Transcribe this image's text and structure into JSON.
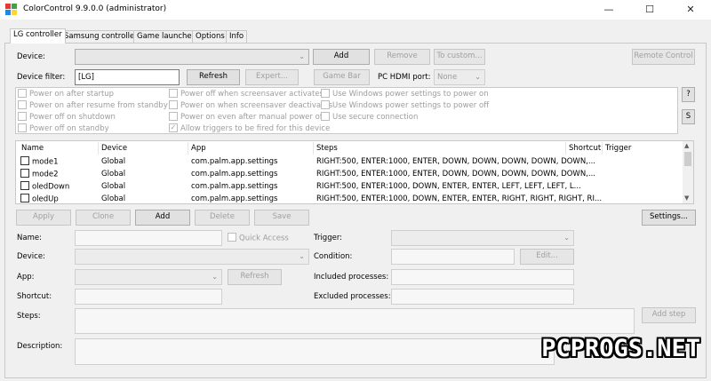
{
  "window": {
    "title": "ColorControl 9.9.0.0 (administrator)"
  },
  "tabs": [
    "LG controller",
    "Samsung controller",
    "Game launcher",
    "Options",
    "Info"
  ],
  "device": {
    "label": "Device:",
    "value": "",
    "add": "Add",
    "remove": "Remove",
    "to_custom": "To custom...",
    "remote_control": "Remote Control",
    "filter_label": "Device filter:",
    "filter_value": "[LG]",
    "refresh": "Refresh",
    "expert": "Expert...",
    "game_bar": "Game Bar",
    "hdmi_label": "PC HDMI port:",
    "hdmi_value": "None"
  },
  "options": {
    "col1": [
      {
        "label": "Power on after startup",
        "checked": false
      },
      {
        "label": "Power on after resume from standby",
        "checked": false
      },
      {
        "label": "Power off on shutdown",
        "checked": false
      },
      {
        "label": "Power off on standby",
        "checked": false
      }
    ],
    "col2": [
      {
        "label": "Power off when screensaver activates",
        "checked": false
      },
      {
        "label": "Power on when screensaver deactivates",
        "checked": false
      },
      {
        "label": "Power on even after manual power off",
        "checked": false
      },
      {
        "label": "Allow triggers to be fired for this device",
        "checked": true
      }
    ],
    "col3": [
      {
        "label": "Use Windows power settings to power on",
        "checked": false
      },
      {
        "label": "Use Windows power settings to power off",
        "checked": false
      },
      {
        "label": "Use secure connection",
        "checked": false
      }
    ],
    "help": "?",
    "s": "S"
  },
  "presets": {
    "headers": [
      "Name",
      "Device",
      "App",
      "Steps",
      "Shortcut",
      "Trigger"
    ],
    "rows": [
      {
        "name": "mode1",
        "device": "Global",
        "app": "com.palm.app.settings",
        "steps": "RIGHT:500, ENTER:1000, ENTER, DOWN, DOWN, DOWN, DOWN, DOWN,..."
      },
      {
        "name": "mode2",
        "device": "Global",
        "app": "com.palm.app.settings",
        "steps": "RIGHT:500, ENTER:1000, ENTER, DOWN, DOWN, DOWN, DOWN, DOWN,..."
      },
      {
        "name": "oledDown",
        "device": "Global",
        "app": "com.palm.app.settings",
        "steps": "RIGHT:500, ENTER:1000, DOWN, ENTER, ENTER, LEFT, LEFT, LEFT, L..."
      },
      {
        "name": "oledUp",
        "device": "Global",
        "app": "com.palm.app.settings",
        "steps": "RIGHT:500, ENTER:1000, DOWN, ENTER, ENTER, RIGHT, RIGHT, RIGHT, RI..."
      }
    ]
  },
  "actions": {
    "apply": "Apply",
    "clone": "Clone",
    "add": "Add",
    "delete": "Delete",
    "save": "Save",
    "settings": "Settings..."
  },
  "form": {
    "name": "Name:",
    "quick_access": "Quick Access",
    "trigger": "Trigger:",
    "device": "Device:",
    "condition": "Condition:",
    "edit": "Edit...",
    "app": "App:",
    "refresh": "Refresh",
    "included": "Included processes:",
    "shortcut": "Shortcut:",
    "excluded": "Excluded processes:",
    "steps": "Steps:",
    "add_step": "Add step",
    "description": "Description:"
  },
  "watermark": "PCPROGS.NET"
}
